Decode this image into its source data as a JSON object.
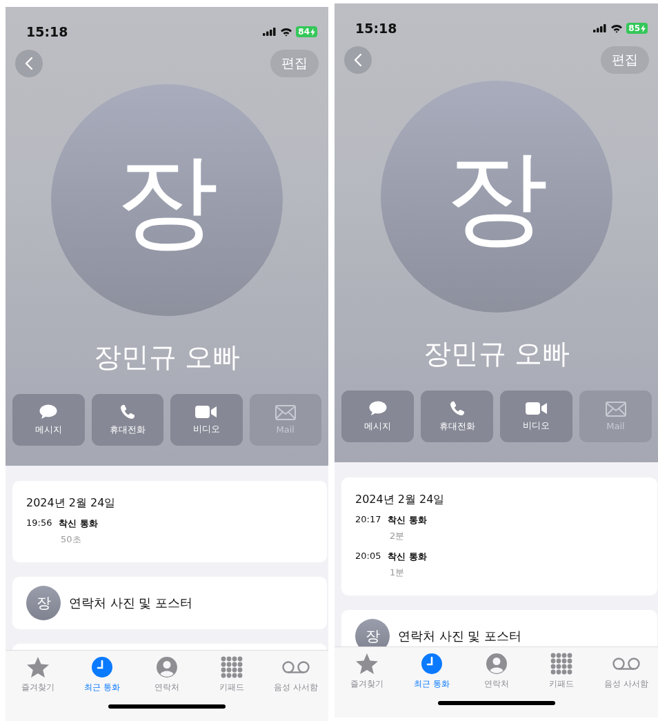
{
  "screens": [
    {
      "status_bar": {
        "time": "15:18",
        "battery": "84"
      },
      "edit_button": "편집",
      "avatar_initial": "장",
      "name": "장민규 오빠",
      "actions": [
        {
          "label": "메시지",
          "kind": "message",
          "disabled": false
        },
        {
          "label": "휴대전화",
          "kind": "phone",
          "disabled": false
        },
        {
          "label": "비디오",
          "kind": "video",
          "disabled": false
        },
        {
          "label": "Mail",
          "kind": "mail",
          "disabled": true
        }
      ],
      "call_log": {
        "date": "2024년 2월 24일",
        "calls": [
          {
            "time": "19:56",
            "type": "착신 통화",
            "duration": "50초"
          }
        ]
      },
      "contact_poster": {
        "initial": "장",
        "label": "연락처 사진 및 포스터"
      },
      "next_card_visible": true,
      "tab_bar": [
        {
          "label": "즐겨찾기",
          "kind": "favorites",
          "selected": false
        },
        {
          "label": "최근 통화",
          "kind": "recents",
          "selected": true
        },
        {
          "label": "연락처",
          "kind": "contacts",
          "selected": false
        },
        {
          "label": "키패드",
          "kind": "keypad",
          "selected": false
        },
        {
          "label": "음성 사서함",
          "kind": "voicemail",
          "selected": false
        }
      ]
    },
    {
      "status_bar": {
        "time": "15:18",
        "battery": "85"
      },
      "edit_button": "편집",
      "avatar_initial": "장",
      "name": "장민규 오빠",
      "actions": [
        {
          "label": "메시지",
          "kind": "message",
          "disabled": false
        },
        {
          "label": "휴대전화",
          "kind": "phone",
          "disabled": false
        },
        {
          "label": "비디오",
          "kind": "video",
          "disabled": false
        },
        {
          "label": "Mail",
          "kind": "mail",
          "disabled": true
        }
      ],
      "call_log": {
        "date": "2024년 2월 24일",
        "calls": [
          {
            "time": "20:17",
            "type": "착신 통화",
            "duration": "2분"
          },
          {
            "time": "20:05",
            "type": "착신 통화",
            "duration": "1분"
          }
        ]
      },
      "contact_poster": {
        "initial": "장",
        "label": "연락처 사진 및 포스터"
      },
      "tab_bar": [
        {
          "label": "즐겨찾기",
          "kind": "favorites",
          "selected": false
        },
        {
          "label": "최근 통화",
          "kind": "recents",
          "selected": true
        },
        {
          "label": "연락처",
          "kind": "contacts",
          "selected": false
        },
        {
          "label": "키패드",
          "kind": "keypad",
          "selected": false
        },
        {
          "label": "음성 사서함",
          "kind": "voicemail",
          "selected": false
        }
      ]
    }
  ]
}
